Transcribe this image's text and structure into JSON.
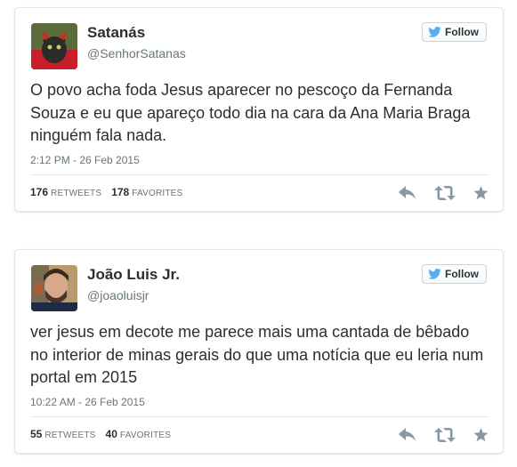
{
  "follow_label": "Follow",
  "colors": {
    "icon_gray": "#8899a6",
    "twitter_blue": "#55acee"
  },
  "tweets": [
    {
      "name": "Satanás",
      "handle": "@SenhorSatanas",
      "text": "O povo acha foda Jesus aparecer no pescoço da Fernanda Souza e eu que apareço todo dia na cara da Ana Maria Braga ninguém fala nada.",
      "time": "2:12 PM - 26 Feb 2015",
      "retweets": "176",
      "retweets_label": "RETWEETS",
      "favorites": "178",
      "favorites_label": "FAVORITES"
    },
    {
      "name": "João Luis Jr.",
      "handle": "@joaoluisjr",
      "text": "ver jesus em decote me parece mais uma cantada de bêbado no interior de minas gerais do que uma notícia que eu leria num portal em 2015",
      "time": "10:22 AM - 26 Feb 2015",
      "retweets": "55",
      "retweets_label": "RETWEETS",
      "favorites": "40",
      "favorites_label": "FAVORITES"
    }
  ]
}
